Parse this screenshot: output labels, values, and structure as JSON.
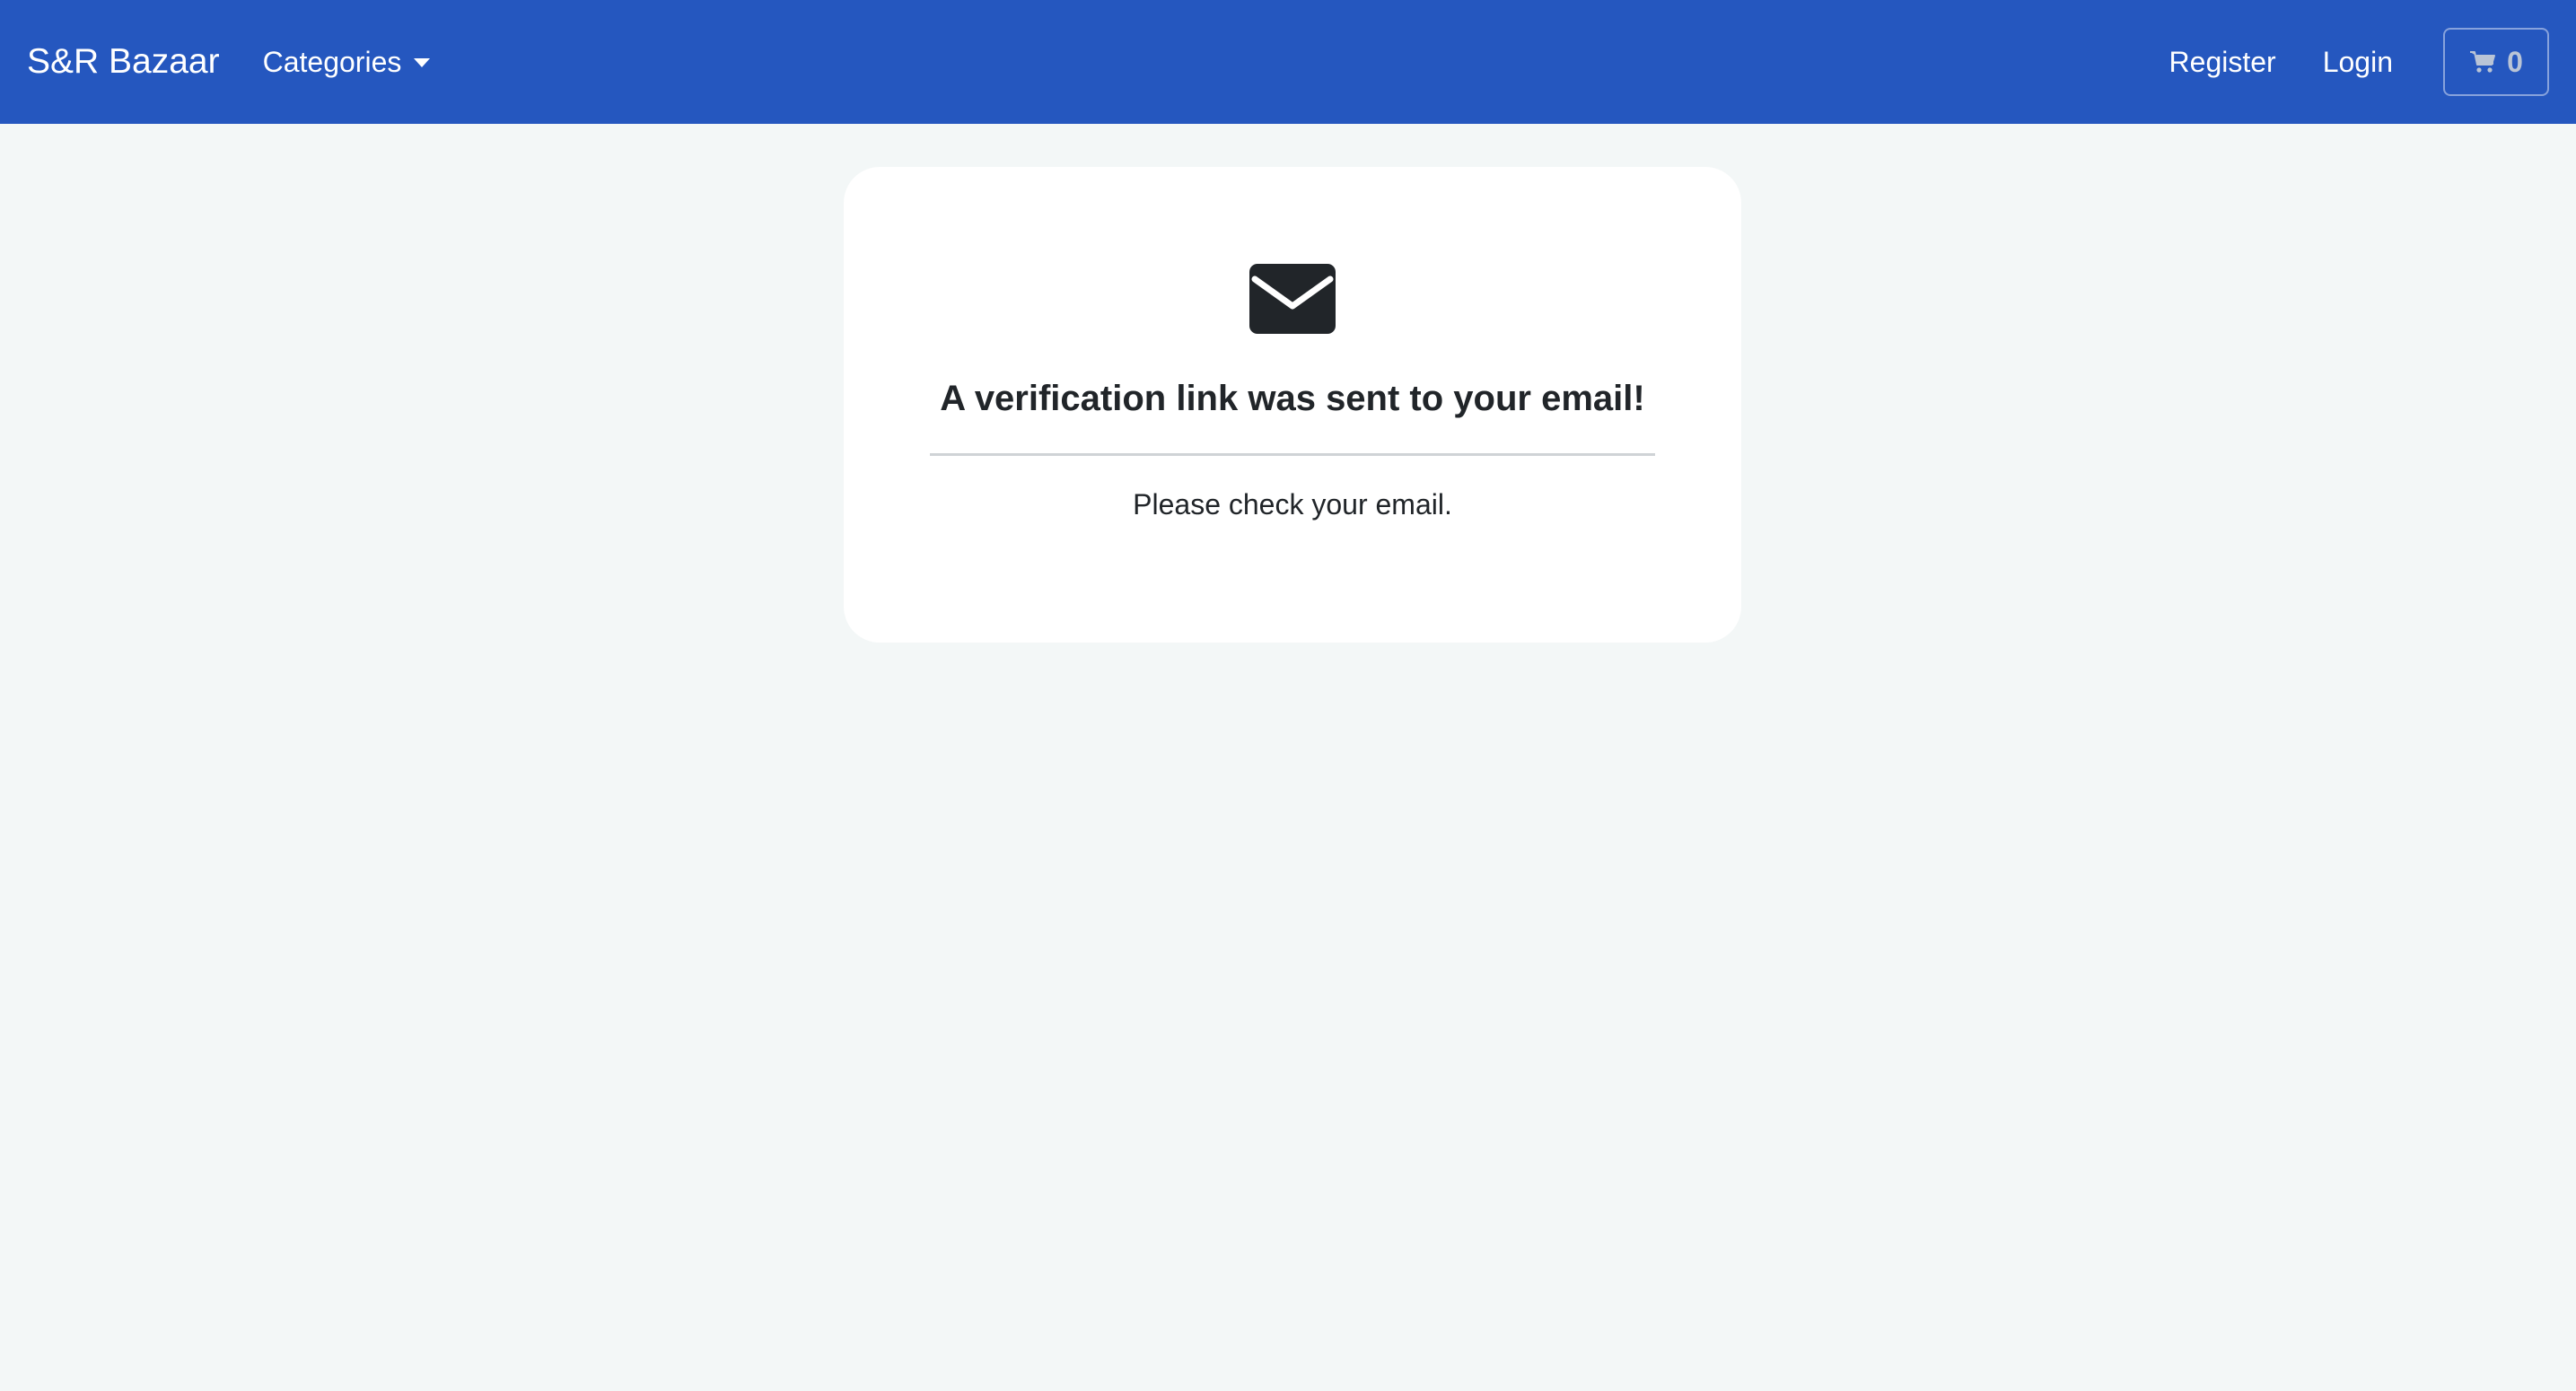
{
  "navbar": {
    "brand": "S&R Bazaar",
    "categories_label": "Categories",
    "register_label": "Register",
    "login_label": "Login",
    "cart": {
      "icon": "shopping-cart-icon",
      "count": "0"
    },
    "background_color": "#2557bf"
  },
  "verification_card": {
    "icon": "envelope-icon",
    "title": "A verification link was sent to your email!",
    "message": "Please check your email."
  },
  "colors": {
    "page_background": "#f3f7f7",
    "card_background": "#ffffff",
    "text": "#212529"
  }
}
